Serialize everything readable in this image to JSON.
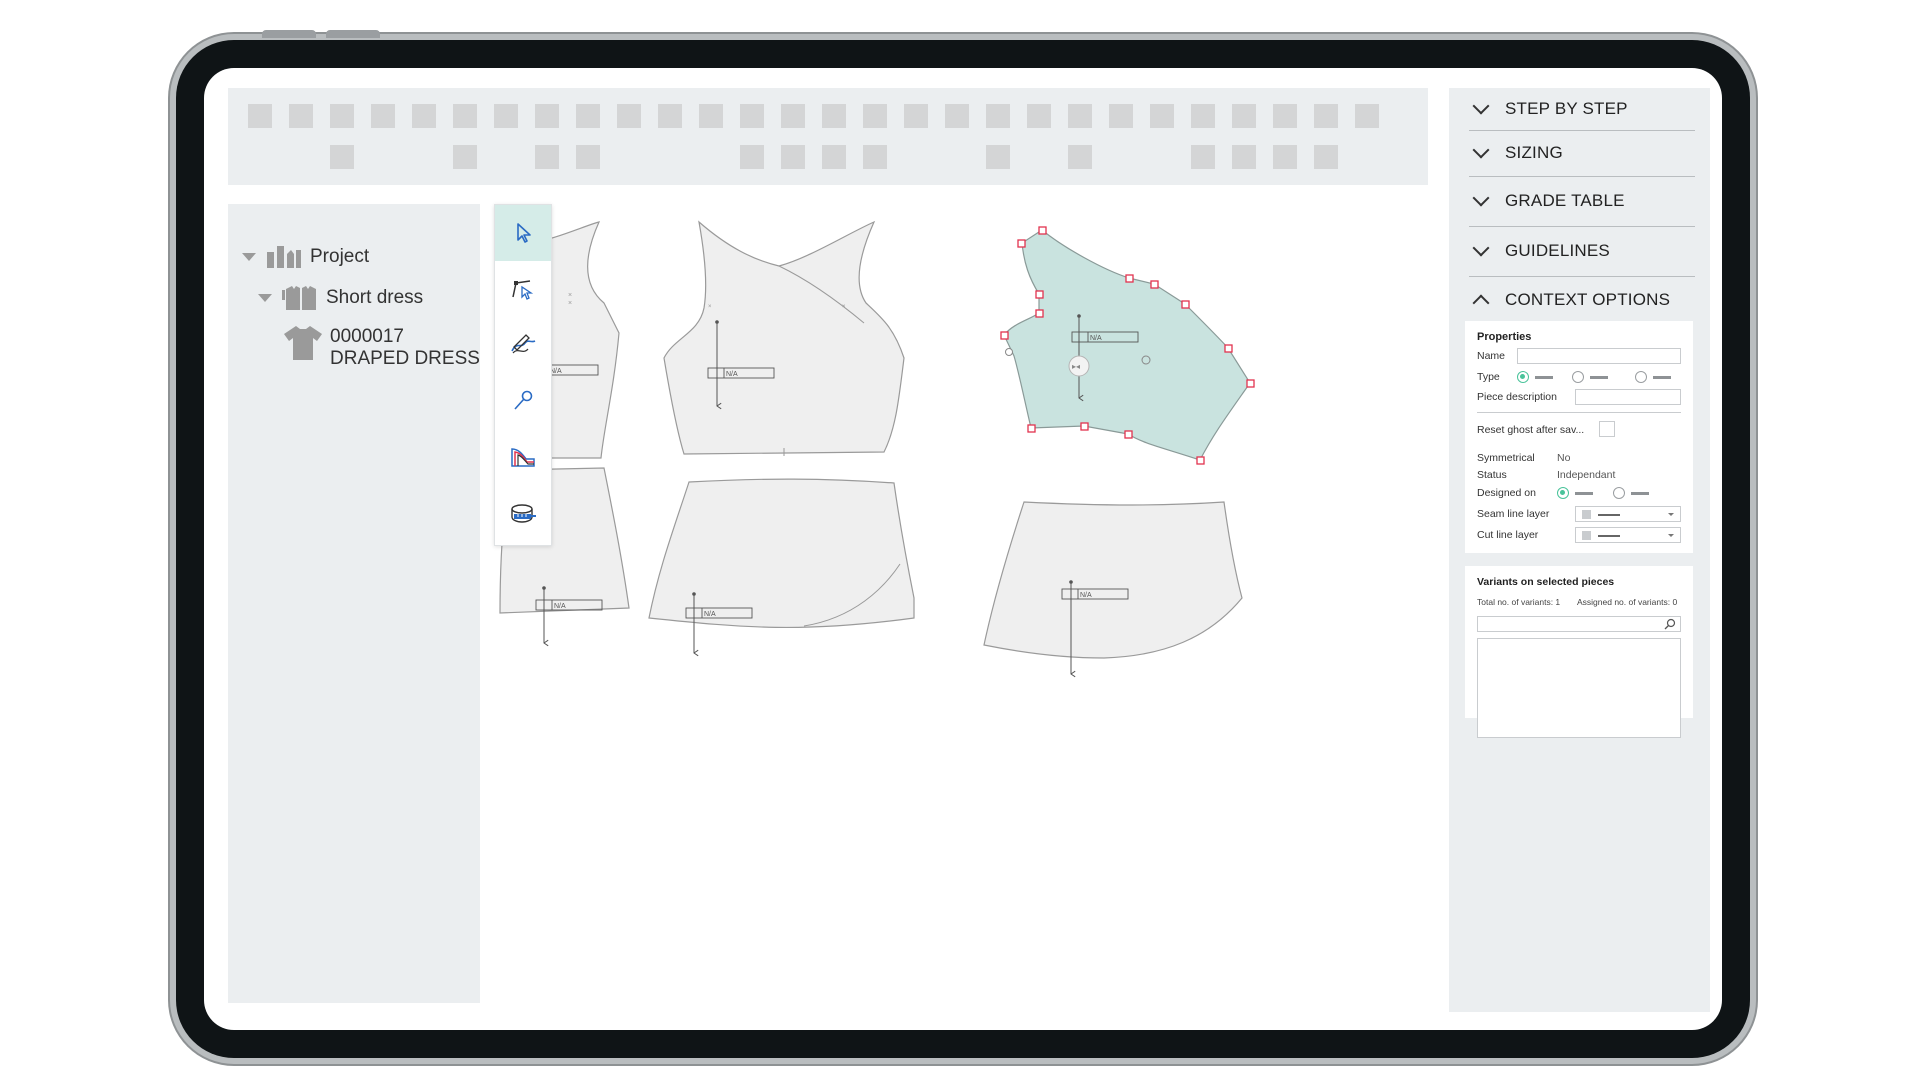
{
  "tree": {
    "project_label": "Project",
    "style_label": "Short dress",
    "item_code": "0000017",
    "item_name": "DRAPED DRESS"
  },
  "tools": [
    {
      "name": "select-tool",
      "icon": "cursor-arrow-icon"
    },
    {
      "name": "point-tool",
      "icon": "point-edit-icon"
    },
    {
      "name": "curve-tool",
      "icon": "curve-pen-icon"
    },
    {
      "name": "pin-tool",
      "icon": "pin-icon"
    },
    {
      "name": "grading-tool",
      "icon": "grading-icon"
    },
    {
      "name": "measure-tool",
      "icon": "tape-measure-icon"
    }
  ],
  "pieces": {
    "label": "N/A"
  },
  "panel": {
    "sections": [
      {
        "label": "STEP BY STEP",
        "expanded": false
      },
      {
        "label": "SIZING",
        "expanded": false
      },
      {
        "label": "GRADE TABLE",
        "expanded": false
      },
      {
        "label": "GUIDELINES",
        "expanded": false
      },
      {
        "label": "CONTEXT OPTIONS",
        "expanded": true
      }
    ],
    "properties": {
      "title": "Properties",
      "name_label": "Name",
      "type_label": "Type",
      "piece_description_label": "Piece description",
      "reset_ghost_label": "Reset ghost after sav...",
      "symmetrical_label": "Symmetrical",
      "symmetrical_value": "No",
      "status_label": "Status",
      "status_value": "Independant",
      "designed_on_label": "Designed on",
      "seam_line_label": "Seam line layer",
      "cut_line_label": "Cut line layer"
    },
    "variants": {
      "title": "Variants on selected pieces",
      "total_label": "Total no. of variants: 1",
      "assigned_label": "Assigned no. of variants: 0"
    }
  },
  "colors": {
    "selected_piece_fill": "#c9e3df",
    "handle_color": "#e2334f",
    "accent_green": "#49c39a",
    "panel_bg": "#ebeef0"
  }
}
